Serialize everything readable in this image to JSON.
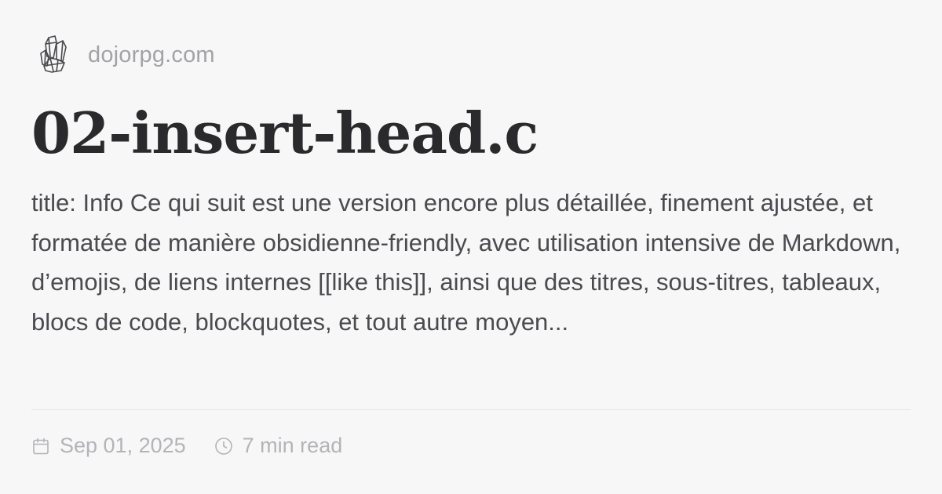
{
  "site": {
    "name": "dojorpg.com",
    "logo_icon": "crystal-icon"
  },
  "post": {
    "title": "02-insert-head.c",
    "excerpt": "title: Info Ce qui suit est une version encore plus détaillée, finement ajustée, et formatée de manière obsidienne-friendly, avec utilisation intensive de Markdown, d’emojis, de liens internes [[like this]], ainsi que des titres, sous-titres, tableaux, blocs de code, blockquotes, et tout autre moyen..."
  },
  "meta": {
    "date": "Sep 01, 2025",
    "date_icon": "calendar-icon",
    "read_time": "7 min read",
    "read_time_icon": "clock-icon"
  },
  "colors": {
    "background": "#f7f7f8",
    "title": "#2a2a2d",
    "excerpt": "#4b4b4f",
    "muted": "#a3a3a6"
  }
}
